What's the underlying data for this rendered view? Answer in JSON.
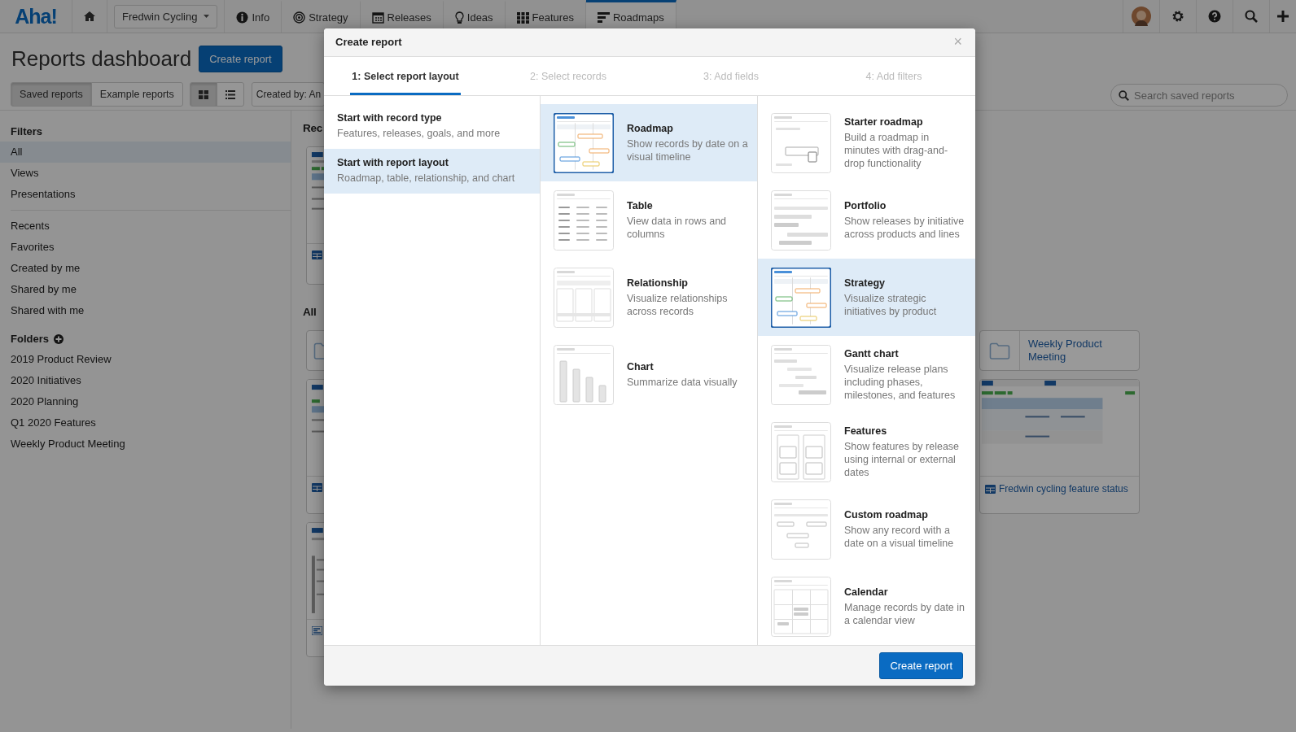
{
  "nav": {
    "logo": "Aha!",
    "project": "Fredwin Cycling",
    "tabs": [
      {
        "label": "Info",
        "selected": false
      },
      {
        "label": "Strategy",
        "selected": false
      },
      {
        "label": "Releases",
        "selected": false
      },
      {
        "label": "Ideas",
        "selected": false
      },
      {
        "label": "Features",
        "selected": false
      },
      {
        "label": "Roadmaps",
        "selected": true
      }
    ]
  },
  "header": {
    "title": "Reports dashboard",
    "create_button": "Create report"
  },
  "toolbar": {
    "report_tabs": [
      {
        "label": "Saved reports",
        "selected": true
      },
      {
        "label": "Example reports",
        "selected": false
      }
    ],
    "views": [
      {
        "kind": "grid",
        "selected": true
      },
      {
        "kind": "list",
        "selected": false
      }
    ],
    "created_by": "Created by: An",
    "search": {
      "placeholder": "Search saved reports"
    }
  },
  "sidebar": {
    "filters_heading": "Filters",
    "filters": [
      {
        "label": "All",
        "selected": true
      },
      {
        "label": "Views",
        "selected": false
      },
      {
        "label": "Presentations",
        "selected": false
      }
    ],
    "lists": [
      {
        "label": "Recents",
        "selected": false
      },
      {
        "label": "Favorites",
        "selected": false
      },
      {
        "label": "Created by me",
        "selected": false
      },
      {
        "label": "Shared by me",
        "selected": false
      },
      {
        "label": "Shared with me",
        "selected": false
      }
    ],
    "folders_heading": "Folders",
    "folders": [
      {
        "label": "2019 Product Review",
        "selected": false
      },
      {
        "label": "2020 Initiatives",
        "selected": false
      },
      {
        "label": "2020 Planning",
        "selected": false
      },
      {
        "label": "Q1 2020 Features",
        "selected": false
      },
      {
        "label": "Weekly Product Meeting",
        "selected": false
      }
    ]
  },
  "main": {
    "recent_heading": "Rec",
    "all_heading": "All",
    "folder_card": {
      "label": "Weekly Product Meeting"
    },
    "report_card": {
      "title": "Fredwin cycling feature status"
    }
  },
  "modal": {
    "title": "Create report",
    "close": "×",
    "steps": [
      {
        "label": "1: Select report layout",
        "selected": true
      },
      {
        "label": "2: Select records",
        "selected": false
      },
      {
        "label": "3: Add fields",
        "selected": false
      },
      {
        "label": "4: Add filters",
        "selected": false
      }
    ],
    "start_options": [
      {
        "title": "Start with record type",
        "description": "Features, releases, goals, and more",
        "selected": false
      },
      {
        "title": "Start with report layout",
        "description": "Roadmap, table, relationship, and chart",
        "selected": true
      }
    ],
    "layouts": [
      {
        "kind": "roadmap",
        "title": "Roadmap",
        "description": "Show records by date on a visual timeline",
        "selected": true
      },
      {
        "kind": "table",
        "title": "Table",
        "description": "View data in rows and columns",
        "selected": false
      },
      {
        "kind": "relationship",
        "title": "Relationship",
        "description": "Visualize relationships across records",
        "selected": false
      },
      {
        "kind": "chart",
        "title": "Chart",
        "description": "Summarize data visually",
        "selected": false
      }
    ],
    "templates": [
      {
        "kind": "starter",
        "title": "Starter roadmap",
        "description": "Build a roadmap in minutes with drag-and-drop functionality",
        "selected": false
      },
      {
        "kind": "portfolio",
        "title": "Portfolio",
        "description": "Show releases by initiative across products and lines",
        "selected": false
      },
      {
        "kind": "strategy",
        "title": "Strategy",
        "description": "Visualize strategic initiatives by product",
        "selected": true
      },
      {
        "kind": "gantt",
        "title": "Gantt chart",
        "description": "Visualize release plans including phases, milestones, and features",
        "selected": false
      },
      {
        "kind": "features",
        "title": "Features",
        "description": "Show features by release using internal or external dates",
        "selected": false
      },
      {
        "kind": "custom",
        "title": "Custom roadmap",
        "description": "Show any record with a date on a visual timeline",
        "selected": false
      },
      {
        "kind": "calendar",
        "title": "Calendar",
        "description": "Manage records by date in a calendar view",
        "selected": false
      }
    ],
    "submit": "Create report"
  }
}
